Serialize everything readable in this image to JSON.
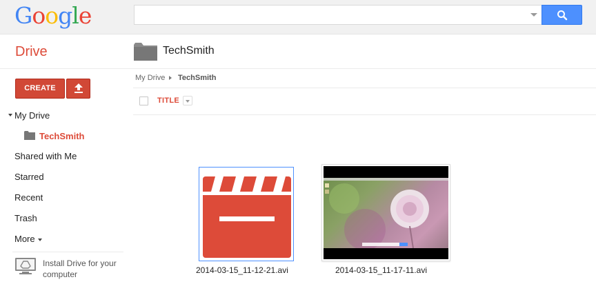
{
  "header": {
    "logo_letters": [
      {
        "ch": "G",
        "color": "#4285f4"
      },
      {
        "ch": "o",
        "color": "#ea4335"
      },
      {
        "ch": "o",
        "color": "#fbbc05"
      },
      {
        "ch": "g",
        "color": "#4285f4"
      },
      {
        "ch": "l",
        "color": "#34a853"
      },
      {
        "ch": "e",
        "color": "#ea4335"
      }
    ],
    "search": {
      "value": "",
      "placeholder": ""
    }
  },
  "app": {
    "title": "Drive"
  },
  "folder": {
    "title": "TechSmith"
  },
  "sidebar": {
    "create_label": "CREATE",
    "items": [
      {
        "label": "My Drive"
      },
      {
        "label": "TechSmith"
      },
      {
        "label": "Shared with Me"
      },
      {
        "label": "Starred"
      },
      {
        "label": "Recent"
      },
      {
        "label": "Trash"
      },
      {
        "label": "More"
      }
    ],
    "install_label": "Install Drive for your computer"
  },
  "breadcrumb": {
    "root": "My Drive",
    "current": "TechSmith"
  },
  "list": {
    "column_title": "TITLE"
  },
  "files": [
    {
      "name": "2014-03-15_11-12-21.avi"
    },
    {
      "name": "2014-03-15_11-17-11.avi"
    }
  ],
  "colors": {
    "accent_red": "#dd4b39",
    "search_blue": "#4d90fe"
  }
}
